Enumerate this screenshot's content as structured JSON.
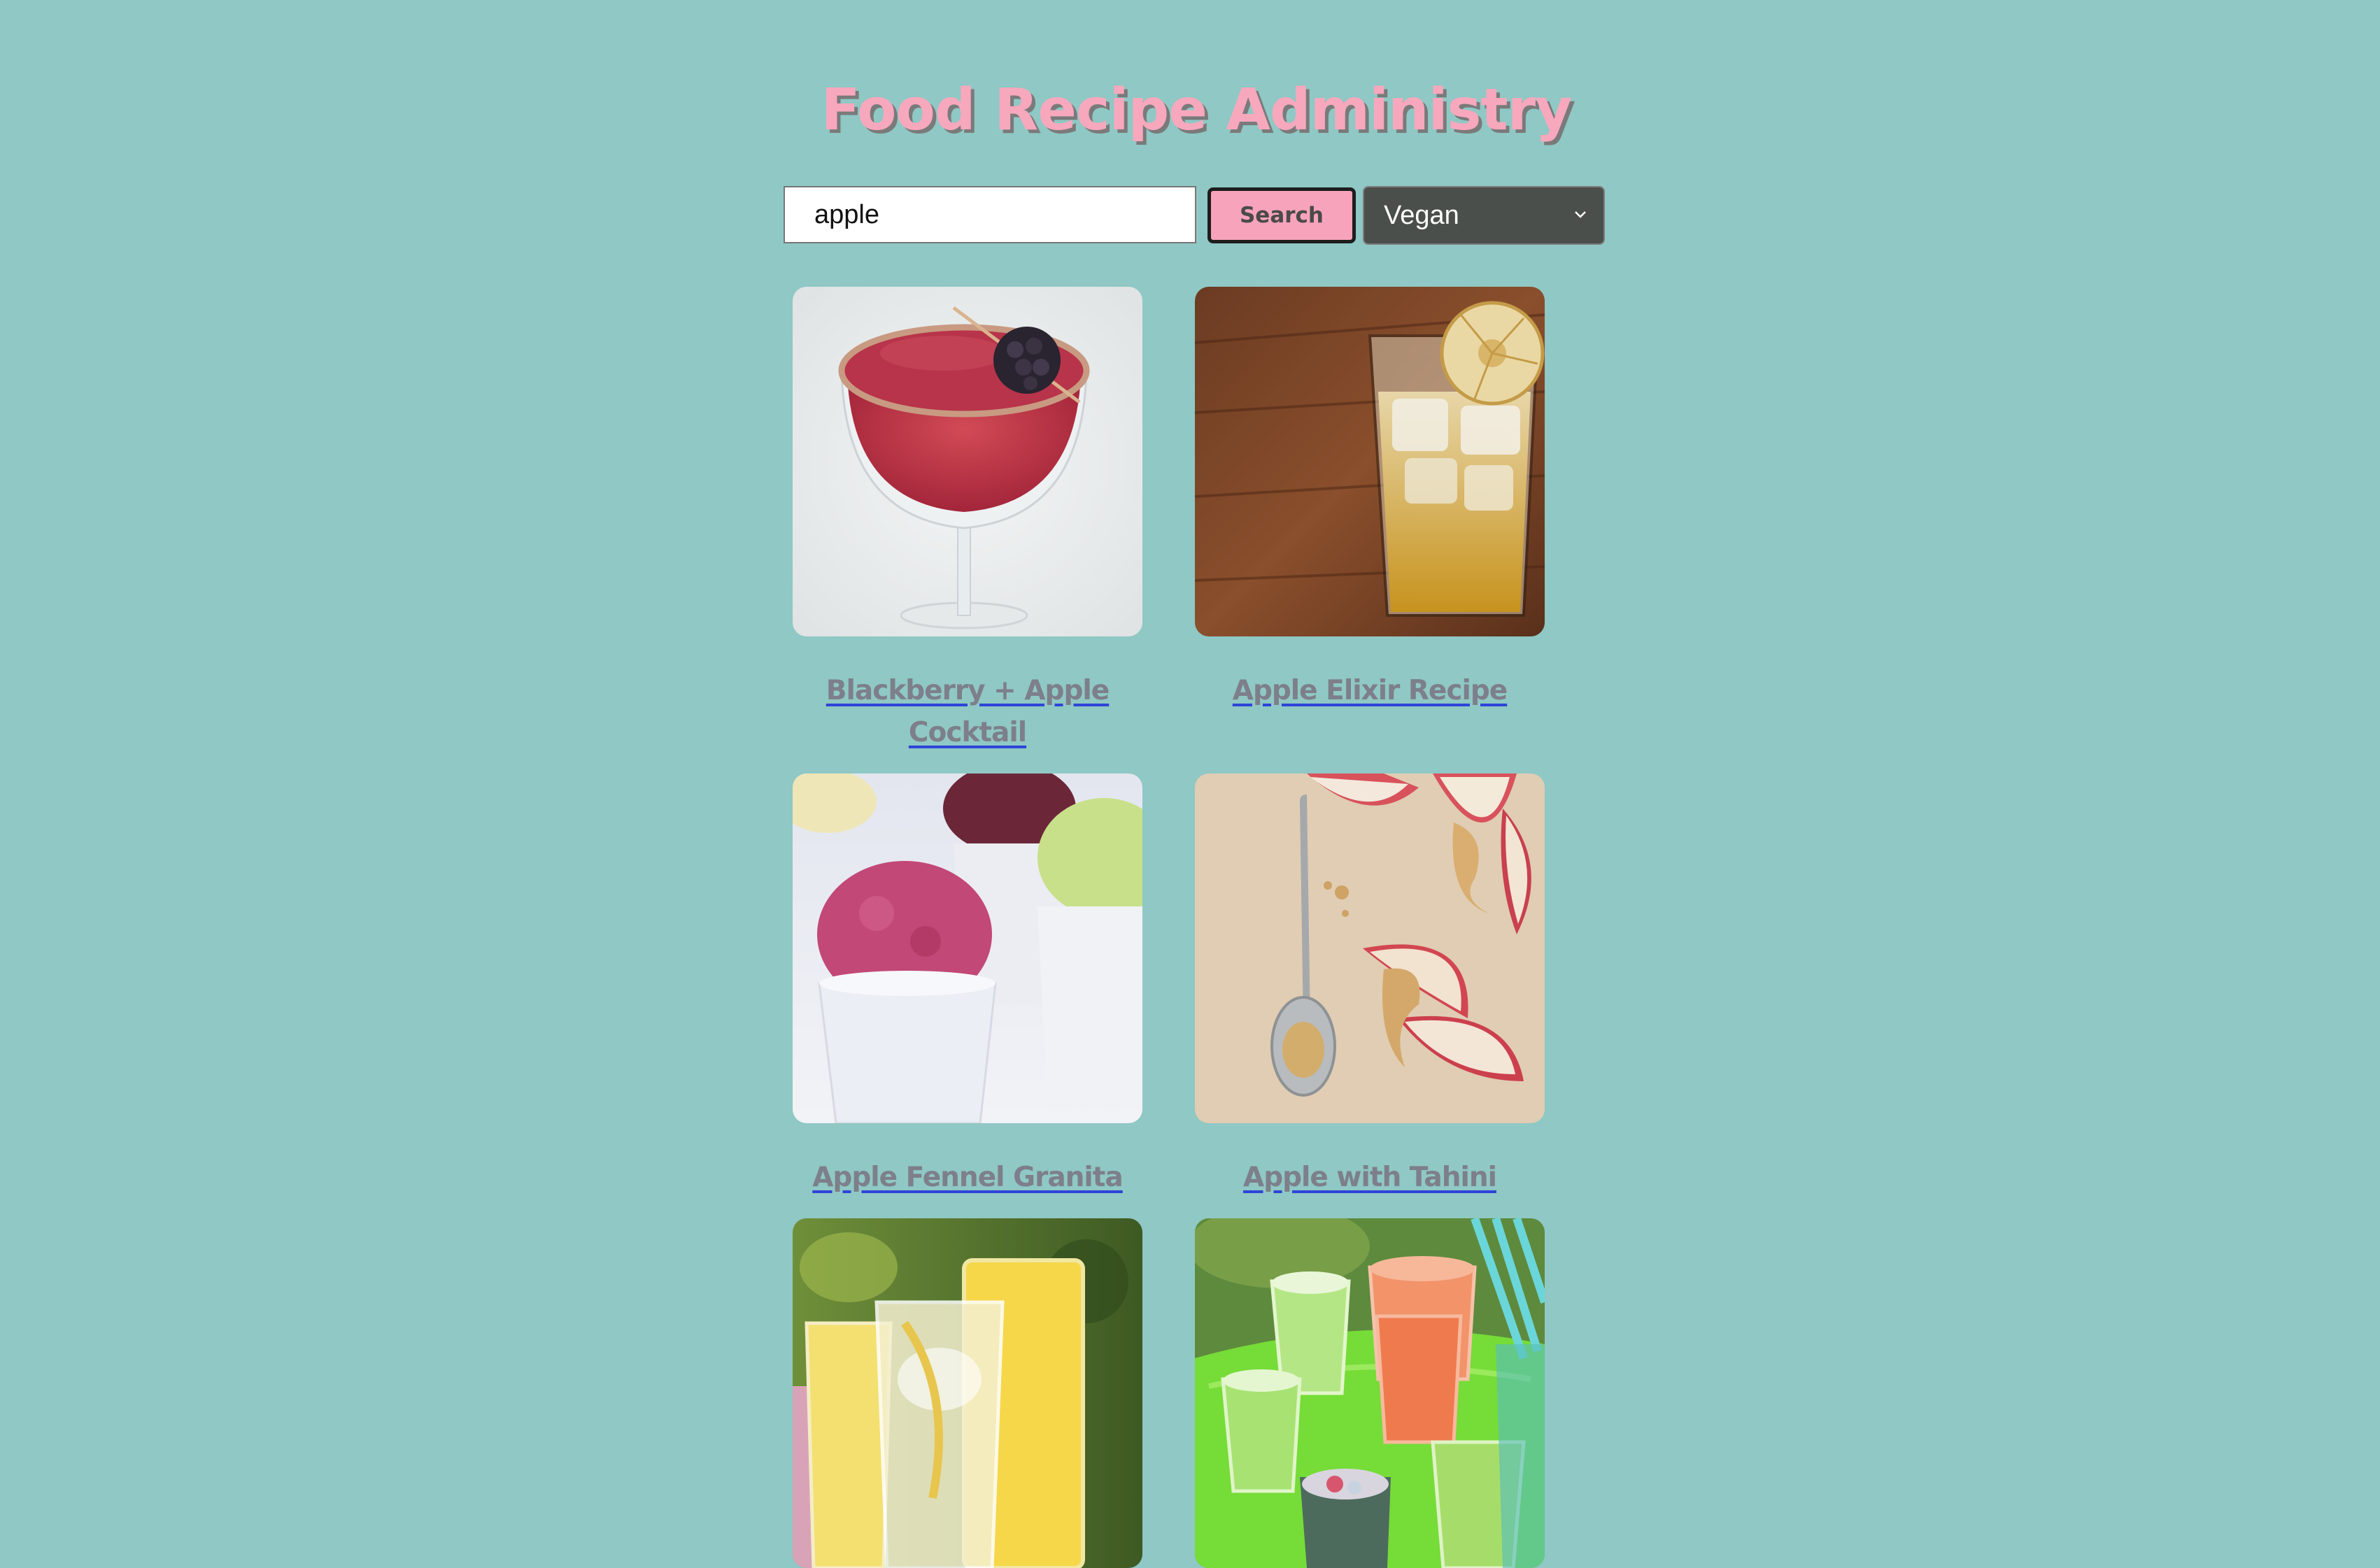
{
  "header": {
    "title": "Food Recipe Administry"
  },
  "search": {
    "value": "apple",
    "button_label": "Search",
    "diet_selected": "Vegan"
  },
  "recipes": [
    {
      "title": "Blackberry + Apple Cocktail",
      "image": "red cocktail with blackberry garnish"
    },
    {
      "title": "Apple Elixir Recipe",
      "image": "iced apple drink with dried apple chip"
    },
    {
      "title": "Apple Fennel Granita",
      "image": "cups of colorful granita"
    },
    {
      "title": "Apple with Tahini",
      "image": "apple slices with tahini drizzle and spoon"
    },
    {
      "title": "",
      "image": "yellow juice glasses"
    },
    {
      "title": "",
      "image": "green and red drinks on green tray"
    }
  ],
  "colors": {
    "background": "#8fc8c4",
    "accent_pink": "#f7a8bd",
    "link_underline": "#2f44d8",
    "select_bg": "#4b4f4b"
  }
}
